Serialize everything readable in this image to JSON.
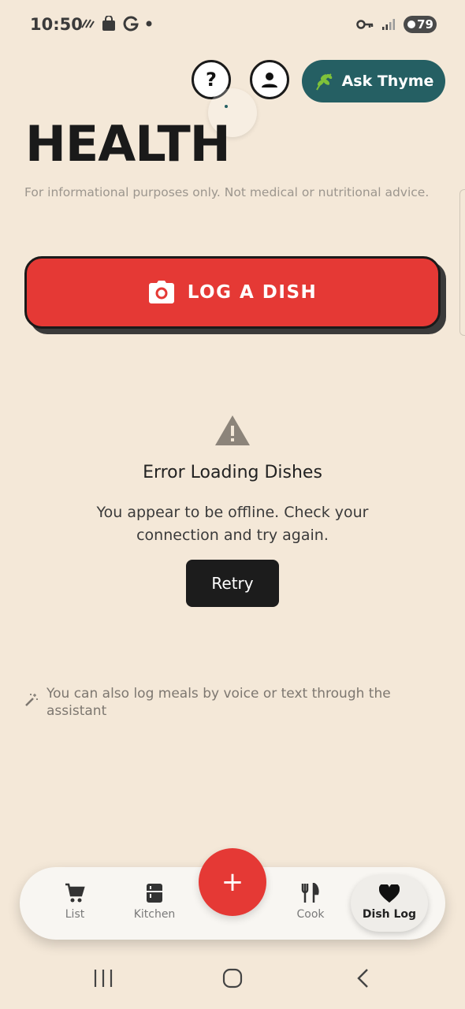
{
  "status_bar": {
    "time": "10:50",
    "battery": "79"
  },
  "header": {
    "help_label": "?",
    "ask_label": "Ask Thyme"
  },
  "page": {
    "title": "HEALTH",
    "disclaimer": "For informational purposes only. Not medical or nutritional advice."
  },
  "log_dish": {
    "label": "LOG A DISH"
  },
  "error": {
    "title": "Error Loading Dishes",
    "message": "You appear to be offline. Check your connection and try again.",
    "retry_label": "Retry"
  },
  "hint": {
    "text": "You can also log meals by voice or text through the assistant"
  },
  "nav": {
    "items": [
      {
        "label": "List",
        "icon": "cart-icon"
      },
      {
        "label": "Kitchen",
        "icon": "fridge-icon"
      },
      {
        "label": "Cook",
        "icon": "fork-knife-icon"
      },
      {
        "label": "Dish Log",
        "icon": "heart-icon",
        "active": true
      }
    ],
    "fab_label": "+"
  },
  "colors": {
    "background": "#f4e8d8",
    "accent_red": "#e53935",
    "teal": "#255f63",
    "dark": "#1c1c1c"
  }
}
